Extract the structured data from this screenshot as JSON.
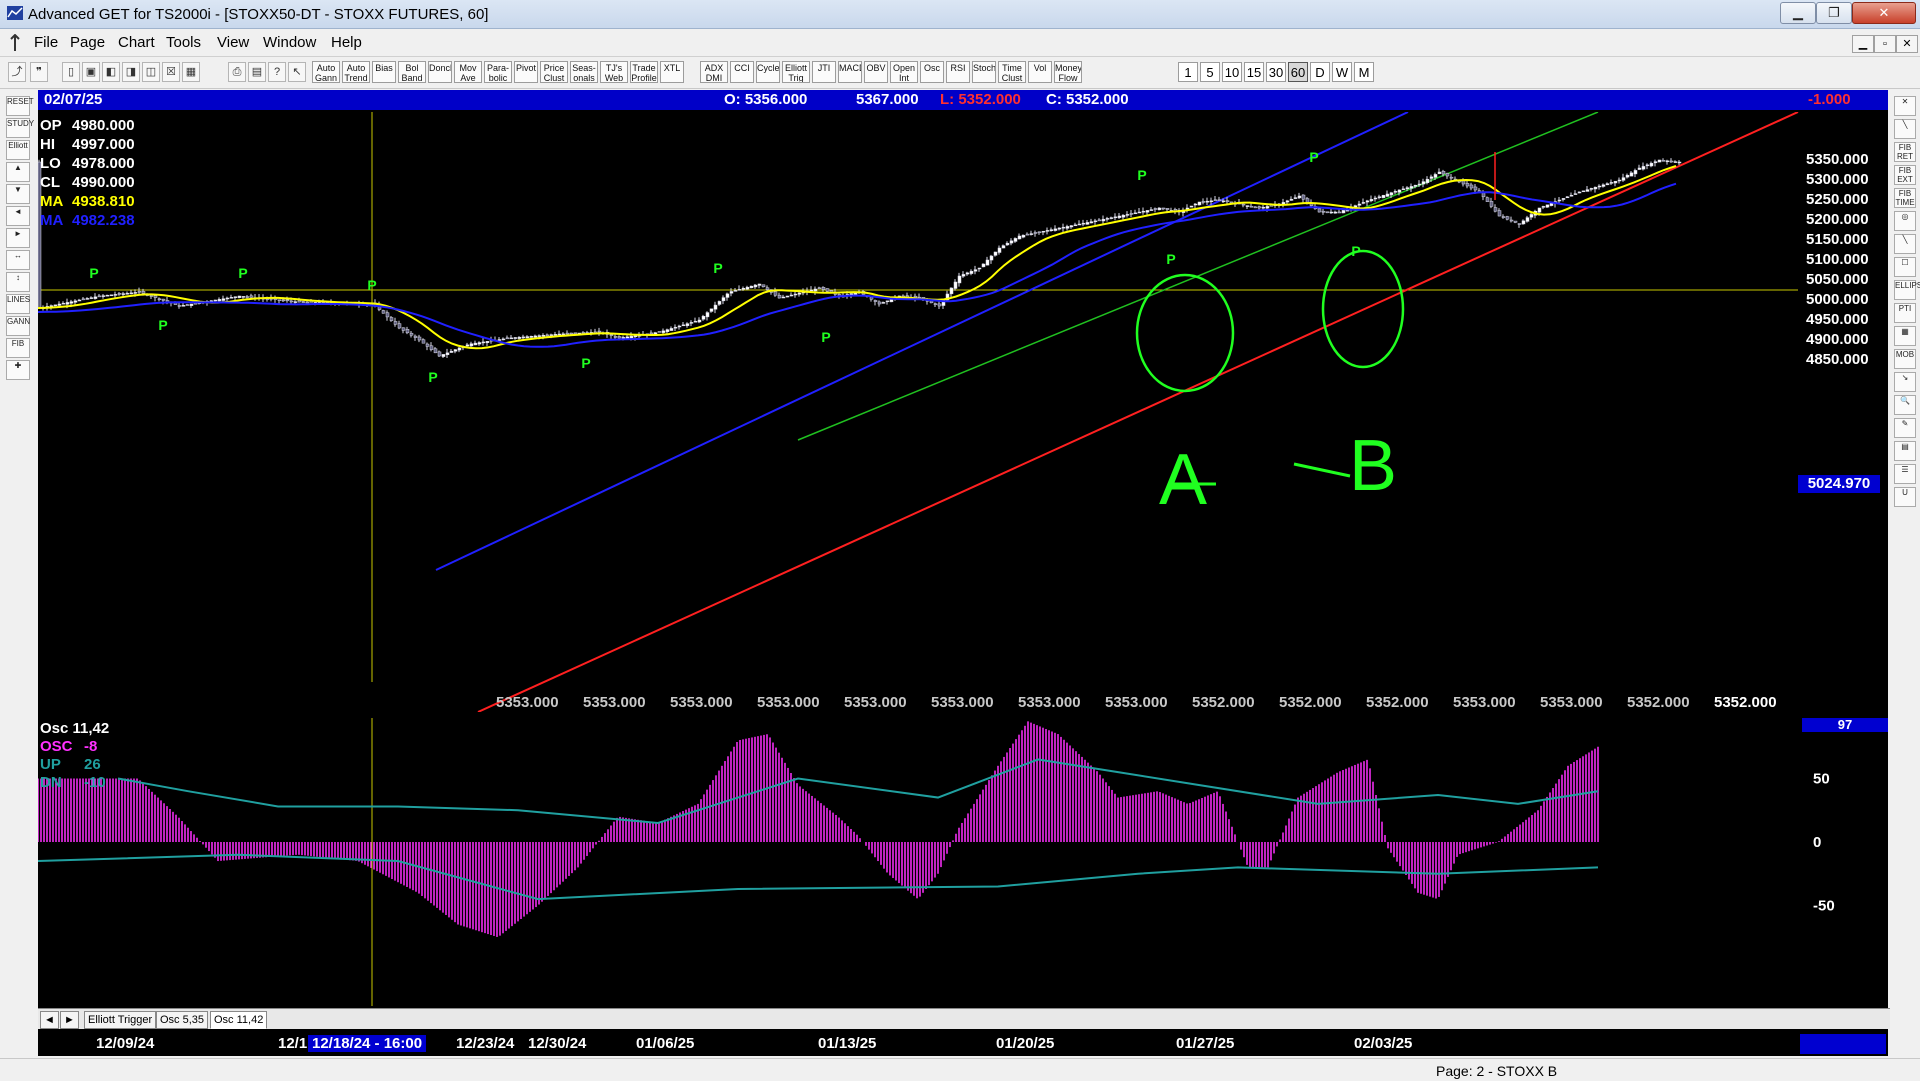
{
  "window": {
    "title": "Advanced GET for TS2000i - [STOXX50-DT - STOXX FUTURES, 60]",
    "controls": [
      "▁",
      "❐",
      "✕"
    ],
    "mdi_controls": [
      "▁",
      "▫",
      "✕"
    ]
  },
  "menu": [
    "File",
    "Page",
    "Chart",
    "Tools",
    "View",
    "Window",
    "Help"
  ],
  "toolbar": {
    "indicators": [
      "Auto Gann",
      "Auto Trend",
      "Bias",
      "Bol Band",
      "Donch",
      "Mov Ave",
      "Para-bolic",
      "Pivot",
      "Price Clust",
      "Seas-onals",
      "TJ's Web",
      "Trade Profile",
      "XTL",
      "ADX DMI",
      "CCI",
      "Cycles",
      "Elliott Trig",
      "JTI",
      "MACD",
      "OBV",
      "Open Int",
      "Osc",
      "RSI",
      "Stoch",
      "Time Clust",
      "Vol",
      "Money Flow"
    ],
    "periods": [
      "1",
      "5",
      "10",
      "15",
      "30",
      "60",
      "D",
      "W",
      "M"
    ],
    "active_period": "60"
  },
  "left_tools": [
    "RESET",
    "STUDY",
    "Elliott",
    "▲",
    "▼",
    "◄",
    "►",
    "↔",
    "↕",
    "LINES",
    "GANN",
    "FIB",
    "✚"
  ],
  "right_tools": [
    "✕",
    "╲",
    "FIB RET",
    "FIB EXT",
    "FIB TIME",
    "◎",
    "╲",
    "☐",
    "ELLIPS",
    "PTI",
    "▦",
    "MOB",
    "↘",
    "🔍",
    "✎",
    "▤",
    "☰",
    "U"
  ],
  "header": {
    "date": "02/07/25",
    "open": "O: 5356.000",
    "high": "5367.000",
    "low": "L: 5352.000",
    "close": "C: 5352.000",
    "change": "-1.000"
  },
  "readout": [
    {
      "label": "OP",
      "value": "4980.000",
      "color": "#ffffff"
    },
    {
      "label": "HI",
      "value": "4997.000",
      "color": "#ffffff"
    },
    {
      "label": "LO",
      "value": "4978.000",
      "color": "#ffffff"
    },
    {
      "label": "CL",
      "value": "4990.000",
      "color": "#ffffff"
    },
    {
      "label": "MA",
      "value": "4938.810",
      "color": "#ffff00"
    },
    {
      "label": "MA",
      "value": "4982.238",
      "color": "#2020ff"
    }
  ],
  "price_scale": [
    "5350.000",
    "5300.000",
    "5250.000",
    "5200.000",
    "5150.000",
    "5100.000",
    "5050.000",
    "5000.000",
    "4950.000",
    "4900.000",
    "4850.000"
  ],
  "current_price": "5024.970",
  "bottom_values": [
    "5353.000",
    "5353.000",
    "5353.000",
    "5353.000",
    "5353.000",
    "5353.000",
    "5353.000",
    "5353.000",
    "5352.000",
    "5352.000",
    "5352.000",
    "5353.000",
    "5353.000",
    "5352.000",
    "5352.000"
  ],
  "annotations": {
    "circle_a": "A",
    "circle_b": "B",
    "pivot": "P"
  },
  "osc": {
    "title": "Osc 11,42",
    "readout": [
      {
        "label": "OSC",
        "value": "-8",
        "color": "#ff30ff"
      },
      {
        "label": "UP",
        "value": "26",
        "color": "#20a0a0"
      },
      {
        "label": "DN",
        "value": "-10",
        "color": "#20a0a0"
      }
    ],
    "scale": [
      "50",
      "0",
      "-50"
    ],
    "current": "97",
    "tabs": [
      "Elliott Trigger",
      "Osc 5,35",
      "Osc 11,42"
    ],
    "active_tab": "Osc 11,42"
  },
  "dates": [
    "12/09/24",
    "12/1",
    "12/18/24 - 16:00",
    "12/23/24",
    "12/30/24",
    "01/06/25",
    "01/13/25",
    "01/20/25",
    "01/27/25",
    "02/03/25"
  ],
  "status": "Page: 2 - STOXX B",
  "colors": {
    "chart_bg": "#000000",
    "header_bar": "#0000c8",
    "upper_channel": "#2020ff",
    "lower_channel": "#ff2020",
    "middle_channel": "#20c020",
    "ma_fast": "#ffff00",
    "ma_slow": "#2020ff",
    "osc_hist": "#ff30ff",
    "osc_bands": "#20a0a0",
    "annotation": "#20ff20"
  }
}
